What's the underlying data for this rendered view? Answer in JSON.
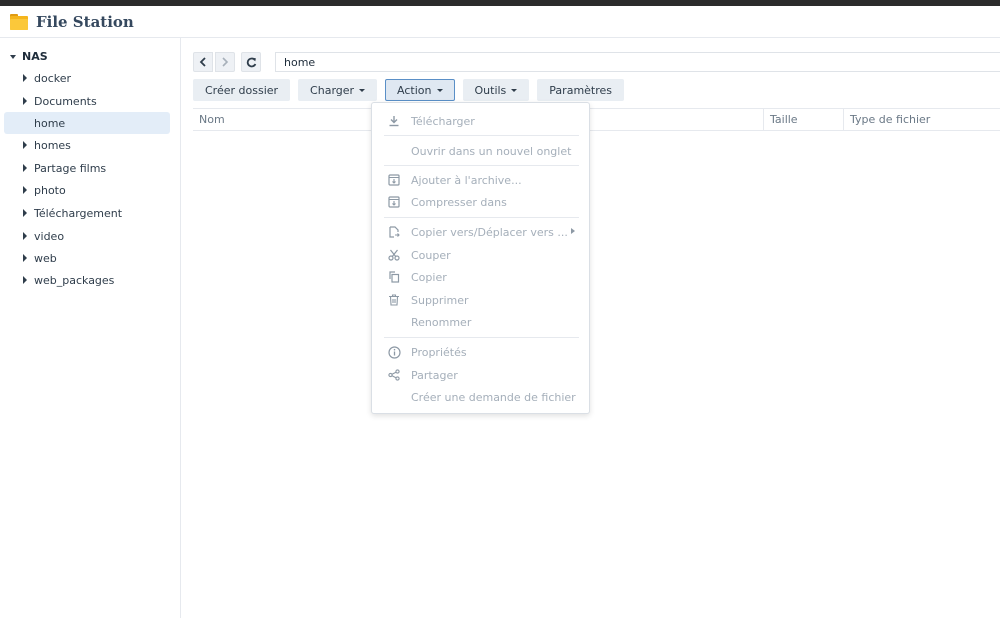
{
  "app": {
    "title": "File Station"
  },
  "sidebar": {
    "root": "NAS",
    "items": [
      {
        "label": "docker"
      },
      {
        "label": "Documents"
      },
      {
        "label": "home"
      },
      {
        "label": "homes"
      },
      {
        "label": "Partage films"
      },
      {
        "label": "photo"
      },
      {
        "label": "Téléchargement"
      },
      {
        "label": "video"
      },
      {
        "label": "web"
      },
      {
        "label": "web_packages"
      }
    ],
    "selected": "home"
  },
  "navigation": {
    "back_icon": "chevron-left-icon",
    "forward_icon": "chevron-right-icon",
    "refresh_icon": "refresh-icon",
    "path": "home"
  },
  "toolbar": {
    "create_folder": "Créer dossier",
    "upload": "Charger",
    "action": "Action",
    "tools": "Outils",
    "settings": "Paramètres"
  },
  "columns": {
    "name": "Nom",
    "size": "Taille",
    "type": "Type de fichier"
  },
  "action_menu": {
    "download": "Télécharger",
    "open_new_tab": "Ouvrir dans un nouvel onglet",
    "add_to_archive": "Ajouter à l'archive...",
    "compress_to": "Compresser dans",
    "copy_move_to": "Copier vers/Déplacer vers ...",
    "cut": "Couper",
    "copy": "Copier",
    "delete": "Supprimer",
    "rename": "Renommer",
    "properties": "Propriétés",
    "share": "Partager",
    "file_request": "Créer une demande de fichier"
  },
  "colors": {
    "accent_border": "#5a8fc7",
    "selected_bg": "#e3edf8",
    "disabled_text": "#a5afba",
    "folder": "#f5b51c"
  }
}
